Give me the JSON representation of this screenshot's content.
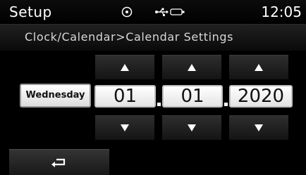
{
  "status_bar": {
    "title": "Setup",
    "clock": "12:05",
    "icons": [
      "disc-icon",
      "usb-icon",
      "battery-icon"
    ]
  },
  "breadcrumb": {
    "text": "Clock/Calendar>Calendar Settings"
  },
  "calendar": {
    "day_of_week": "Wednesday",
    "month": "01",
    "day": "01",
    "year": "2020",
    "separator": "."
  },
  "controls": {
    "up_icon": "up-arrow-icon",
    "down_icon": "down-arrow-icon",
    "back_icon": "back-arrow-icon"
  },
  "colors": {
    "background": "#000000",
    "field_bg": "#ffffff",
    "button_bg": "#2a2a2a",
    "text_light": "#ffffff"
  }
}
